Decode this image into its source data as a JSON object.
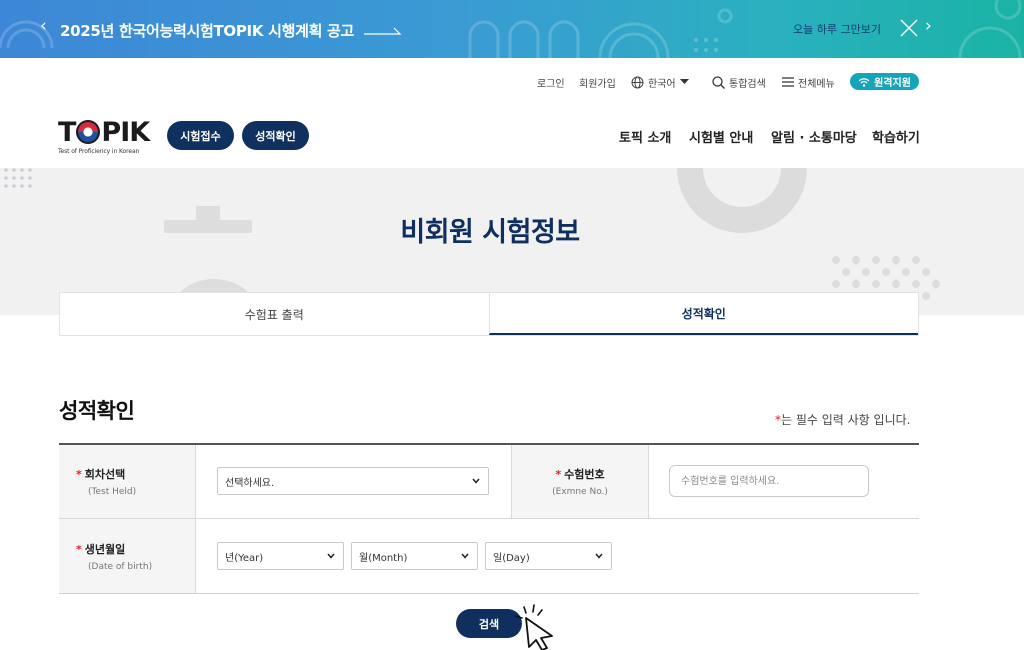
{
  "banner": {
    "title": "2025년 한국어능력시험TOPIK 시행계획 공고",
    "hide_today": "오늘 하루 그만보기",
    "prev_icon": "chevron-left-icon",
    "next_icon": "chevron-right-icon",
    "close_icon": "close-icon"
  },
  "util": {
    "login": "로그인",
    "join": "회원가입",
    "language": "한국어",
    "search": "통합검색",
    "menu": "전체메뉴",
    "remote": "원격지원"
  },
  "header": {
    "logo_text": "TOPIK",
    "logo_sub": "Test of Proficiency in Korean",
    "apply": "시험접수",
    "result": "성적확인",
    "nav": [
      "토픽 소개",
      "시험별 안내",
      "알림 · 소통마당",
      "학습하기"
    ]
  },
  "hero": {
    "title": "비회원 시험정보"
  },
  "tabs": [
    "수험표 출력",
    "성적확인"
  ],
  "section": {
    "title": "성적확인",
    "required_star": "*",
    "required_note": "는 필수 입력 사항 입니다."
  },
  "form": {
    "round": {
      "label": "회차선택",
      "sub": "(Test Held)",
      "value": "선택하세요."
    },
    "exam_no": {
      "label": "수험번호",
      "sub": "(Exmne No.)",
      "placeholder": "수험번호를 입력하세요."
    },
    "birth": {
      "label": "생년월일",
      "sub": "(Date of birth)",
      "year": "년(Year)",
      "month": "월(Month)",
      "day": "일(Day)"
    },
    "star": "*"
  },
  "search_button": "검색",
  "colors": {
    "navy": "#0f2f5e",
    "accent": "#17a4b9",
    "required": "#e0192d"
  }
}
